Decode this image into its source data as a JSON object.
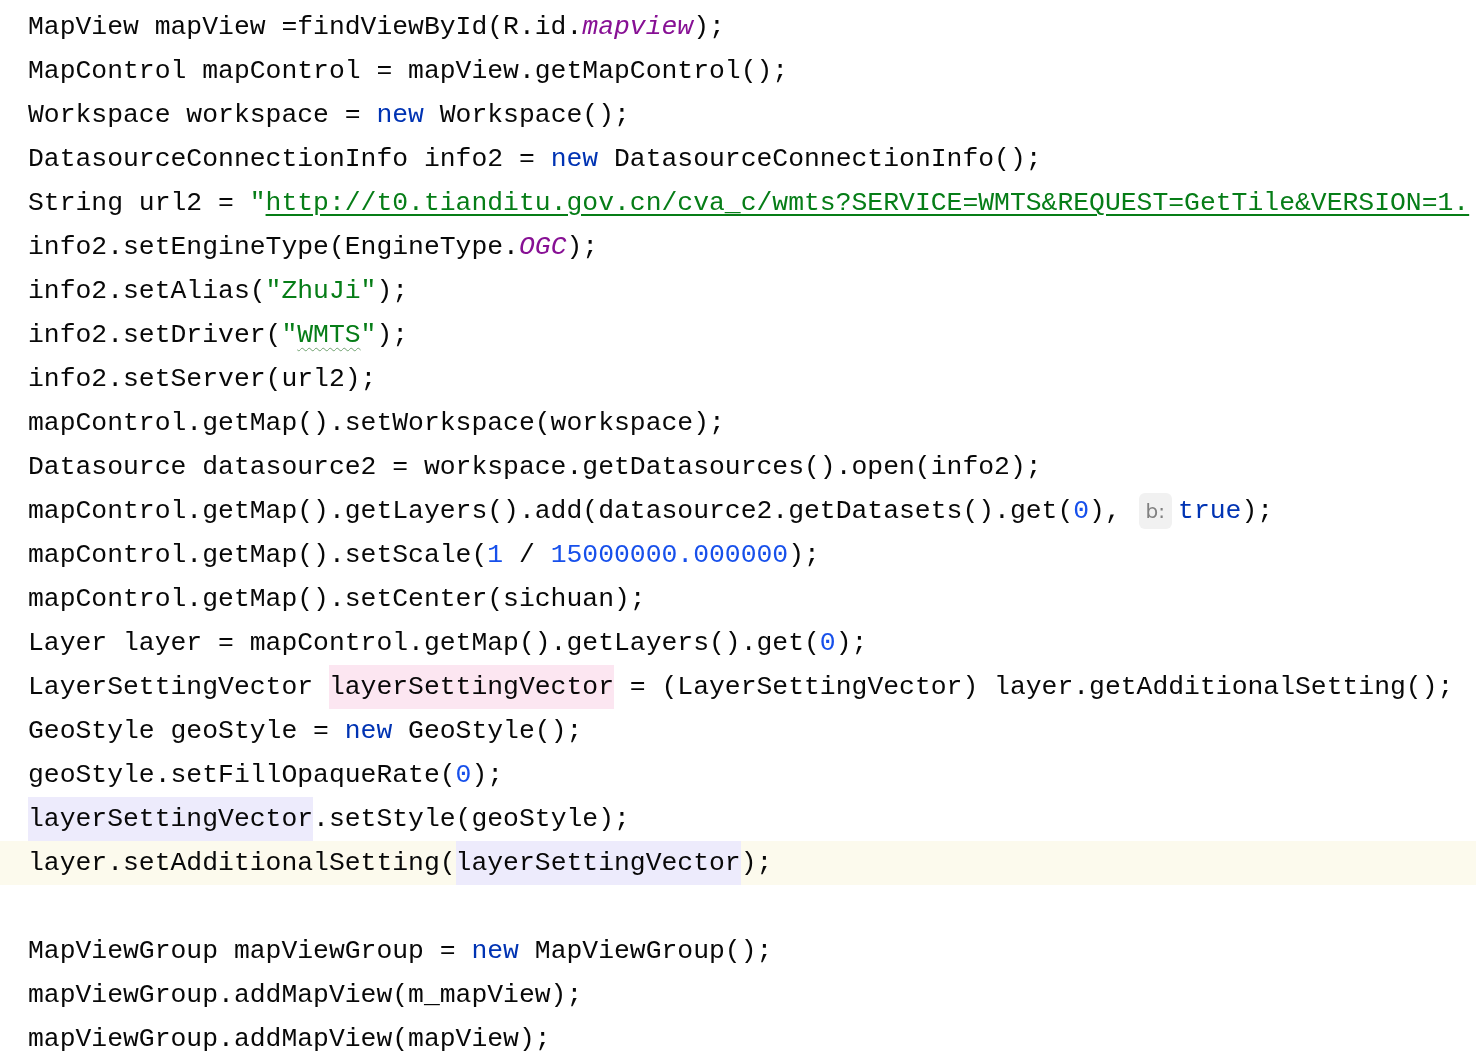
{
  "editor": {
    "lines": [
      {
        "kind": "code",
        "current": false,
        "tokens": [
          {
            "text": "MapView mapView =findViewById(R.id.",
            "kind": "plain"
          },
          {
            "text": "mapview",
            "kind": "field"
          },
          {
            "text": ");",
            "kind": "plain"
          }
        ]
      },
      {
        "kind": "code",
        "current": false,
        "tokens": [
          {
            "text": "MapControl mapControl = mapView.getMapControl();",
            "kind": "plain"
          }
        ]
      },
      {
        "kind": "code",
        "current": false,
        "tokens": [
          {
            "text": "Workspace workspace = ",
            "kind": "plain"
          },
          {
            "text": "new",
            "kind": "keyword"
          },
          {
            "text": " Workspace();",
            "kind": "plain"
          }
        ]
      },
      {
        "kind": "code",
        "current": false,
        "tokens": [
          {
            "text": "DatasourceConnectionInfo info2 = ",
            "kind": "plain"
          },
          {
            "text": "new",
            "kind": "keyword"
          },
          {
            "text": " DatasourceConnectionInfo();",
            "kind": "plain"
          }
        ]
      },
      {
        "kind": "code",
        "current": false,
        "tokens": [
          {
            "text": "String url2 = ",
            "kind": "plain"
          },
          {
            "text": "\"",
            "kind": "string"
          },
          {
            "text": "http://t0.tianditu.gov.cn/cva_c/wmts?SERVICE=WMTS&REQUEST=GetTile&VERSION=1.",
            "kind": "link"
          }
        ]
      },
      {
        "kind": "code",
        "current": false,
        "tokens": [
          {
            "text": "info2.setEngineType(EngineType.",
            "kind": "plain"
          },
          {
            "text": "OGC",
            "kind": "field"
          },
          {
            "text": ");",
            "kind": "plain"
          }
        ]
      },
      {
        "kind": "code",
        "current": false,
        "tokens": [
          {
            "text": "info2.setAlias(",
            "kind": "plain"
          },
          {
            "text": "\"ZhuJi\"",
            "kind": "string"
          },
          {
            "text": ");",
            "kind": "plain"
          }
        ]
      },
      {
        "kind": "code",
        "current": false,
        "tokens": [
          {
            "text": "info2.setDriver(",
            "kind": "plain"
          },
          {
            "text": "\"",
            "kind": "string"
          },
          {
            "text": "WMTS",
            "kind": "misspelled"
          },
          {
            "text": "\"",
            "kind": "string"
          },
          {
            "text": ");",
            "kind": "plain"
          }
        ]
      },
      {
        "kind": "code",
        "current": false,
        "tokens": [
          {
            "text": "info2.setServer(url2);",
            "kind": "plain"
          }
        ]
      },
      {
        "kind": "code",
        "current": false,
        "tokens": [
          {
            "text": "mapControl.getMap().setWorkspace(workspace);",
            "kind": "plain"
          }
        ]
      },
      {
        "kind": "code",
        "current": false,
        "tokens": [
          {
            "text": "Datasource datasource2 = workspace.getDatasources().open(info2);",
            "kind": "plain"
          }
        ]
      },
      {
        "kind": "code",
        "current": false,
        "tokens": [
          {
            "text": "mapControl.getMap().getLayers().add(datasource2.getDatasets().get(",
            "kind": "plain"
          },
          {
            "text": "0",
            "kind": "number"
          },
          {
            "text": "), ",
            "kind": "plain"
          },
          {
            "text": "b:",
            "kind": "hint"
          },
          {
            "text": "true",
            "kind": "keyword"
          },
          {
            "text": ");",
            "kind": "plain"
          }
        ]
      },
      {
        "kind": "code",
        "current": false,
        "tokens": [
          {
            "text": "mapControl.getMap().setScale(",
            "kind": "plain"
          },
          {
            "text": "1",
            "kind": "number"
          },
          {
            "text": " / ",
            "kind": "plain"
          },
          {
            "text": "15000000.000000",
            "kind": "number"
          },
          {
            "text": ");",
            "kind": "plain"
          }
        ]
      },
      {
        "kind": "code",
        "current": false,
        "tokens": [
          {
            "text": "mapControl.getMap().setCenter(sichuan);",
            "kind": "plain"
          }
        ]
      },
      {
        "kind": "code",
        "current": false,
        "tokens": [
          {
            "text": "Layer layer = mapControl.getMap().getLayers().get(",
            "kind": "plain"
          },
          {
            "text": "0",
            "kind": "number"
          },
          {
            "text": ");",
            "kind": "plain"
          }
        ]
      },
      {
        "kind": "code",
        "current": false,
        "tokens": [
          {
            "text": "LayerSettingVector ",
            "kind": "plain"
          },
          {
            "text": "layerSettingVector",
            "kind": "write-usage"
          },
          {
            "text": " = (LayerSettingVector) layer.getAdditionalSetting();",
            "kind": "plain"
          }
        ]
      },
      {
        "kind": "code",
        "current": false,
        "tokens": [
          {
            "text": "GeoStyle geoStyle = ",
            "kind": "plain"
          },
          {
            "text": "new",
            "kind": "keyword"
          },
          {
            "text": " GeoStyle();",
            "kind": "plain"
          }
        ]
      },
      {
        "kind": "code",
        "current": false,
        "tokens": [
          {
            "text": "geoStyle.setFillOpaqueRate(",
            "kind": "plain"
          },
          {
            "text": "0",
            "kind": "number"
          },
          {
            "text": ");",
            "kind": "plain"
          }
        ]
      },
      {
        "kind": "code",
        "current": false,
        "tokens": [
          {
            "text": "layerSettingVector",
            "kind": "read-usage"
          },
          {
            "text": ".setStyle(geoStyle);",
            "kind": "plain"
          }
        ]
      },
      {
        "kind": "code",
        "current": true,
        "tokens": [
          {
            "text": "layer.setAdditionalSetting(",
            "kind": "plain"
          },
          {
            "text": "layerSettingVector",
            "kind": "read-usage"
          },
          {
            "text": ");",
            "kind": "plain"
          }
        ]
      },
      {
        "kind": "blank",
        "current": false
      },
      {
        "kind": "code",
        "current": false,
        "tokens": [
          {
            "text": "MapViewGroup mapViewGroup = ",
            "kind": "plain"
          },
          {
            "text": "new",
            "kind": "keyword"
          },
          {
            "text": " MapViewGroup();",
            "kind": "plain"
          }
        ]
      },
      {
        "kind": "code",
        "current": false,
        "tokens": [
          {
            "text": "mapViewGroup.addMapView(m_mapView);",
            "kind": "plain"
          }
        ]
      },
      {
        "kind": "code",
        "current": false,
        "tokens": [
          {
            "text": "mapViewGroup.addMapView(mapView);",
            "kind": "plain"
          }
        ]
      }
    ]
  }
}
